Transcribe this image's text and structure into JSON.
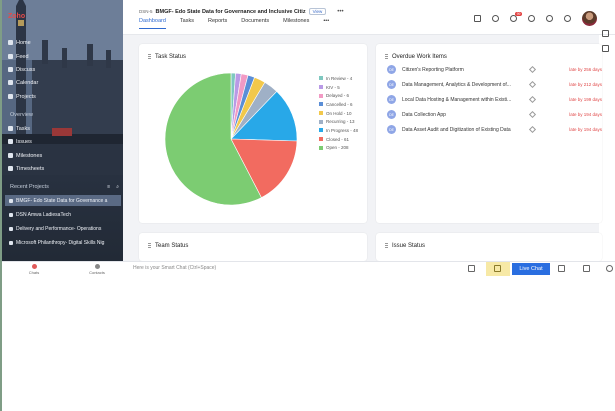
{
  "sidebar": {
    "logo": "Zoho",
    "nav": [
      {
        "label": "Home",
        "icon": "home-icon"
      },
      {
        "label": "Feed",
        "icon": "feed-icon"
      },
      {
        "label": "Discuss",
        "icon": "discuss-icon"
      },
      {
        "label": "Calendar",
        "icon": "calendar-icon"
      },
      {
        "label": "Projects",
        "icon": "projects-icon"
      }
    ],
    "overview_title": "Overview",
    "overview": [
      {
        "label": "Tasks",
        "icon": "tasks-icon"
      },
      {
        "label": "Issues",
        "icon": "issues-icon"
      },
      {
        "label": "Milestones",
        "icon": "milestones-icon"
      },
      {
        "label": "Timesheets",
        "icon": "timesheets-icon"
      }
    ],
    "recent_title": "Recent Projects",
    "recent": [
      {
        "label": "BMGF- Edo State Data for Governance a",
        "active": true
      },
      {
        "label": "DSN Amwa LadiesaTech",
        "active": false
      },
      {
        "label": "Delivery and Performance- Operations",
        "active": false
      },
      {
        "label": "Microsoft Philanthropy- Digital Skills Nig",
        "active": false
      }
    ]
  },
  "header": {
    "project_code": "DSN-5",
    "project_name": "BMGF- Edo State Data for Governance and Inclusive Citiz",
    "view_label": "View",
    "more": "•••",
    "tabs": [
      "Dashboard",
      "Tasks",
      "Reports",
      "Documents",
      "Milestones",
      "•••"
    ],
    "active_tab": "Dashboard",
    "notification_count": "99"
  },
  "task_status": {
    "title": "Task Status",
    "legend": [
      {
        "label": "In Review - 4",
        "color": "#7fc8c0"
      },
      {
        "label": "KIV - 5",
        "color": "#b99ae6"
      },
      {
        "label": "Delayed - 6",
        "color": "#f29ac4"
      },
      {
        "label": "Cancelled - 6",
        "color": "#5b8ed6"
      },
      {
        "label": "On Hold - 10",
        "color": "#f2c84b"
      },
      {
        "label": "Recurring - 13",
        "color": "#9fb0c6"
      },
      {
        "label": "In Progress - 48",
        "color": "#28a8e8"
      },
      {
        "label": "Closed - 61",
        "color": "#f26b60"
      },
      {
        "label": "Open - 208",
        "color": "#7ccc72"
      }
    ]
  },
  "chart_data": {
    "type": "pie",
    "title": "Task Status",
    "slices": [
      {
        "label": "In Review",
        "value": 4,
        "color": "#7fc8c0"
      },
      {
        "label": "KIV",
        "value": 5,
        "color": "#b99ae6"
      },
      {
        "label": "Delayed",
        "value": 6,
        "color": "#f29ac4"
      },
      {
        "label": "Cancelled",
        "value": 6,
        "color": "#5b8ed6"
      },
      {
        "label": "On Hold",
        "value": 10,
        "color": "#f2c84b"
      },
      {
        "label": "Recurring",
        "value": 13,
        "color": "#9fb0c6"
      },
      {
        "label": "In Progress",
        "value": 48,
        "color": "#28a8e8"
      },
      {
        "label": "Closed",
        "value": 61,
        "color": "#f26b60"
      },
      {
        "label": "Open",
        "value": 208,
        "color": "#7ccc72"
      }
    ],
    "legend_position": "right"
  },
  "overdue": {
    "title": "Overdue Work Items",
    "items": [
      {
        "initials": "DE",
        "name": "Citizen's Reporting Platform",
        "late": "late by 256 days"
      },
      {
        "initials": "DE",
        "name": "Data Management, Analytics & Development of...",
        "late": "late by 212 days"
      },
      {
        "initials": "DE",
        "name": "Local Data Hosting & Management within Existi...",
        "late": "late by 199 days"
      },
      {
        "initials": "DE",
        "name": "Data Collection App",
        "late": "late by 194 days"
      },
      {
        "initials": "DE",
        "name": "Data Asset Audit and Digitization of Existing Data",
        "late": "late by 194 days"
      }
    ]
  },
  "team_status": {
    "title": "Team Status"
  },
  "issue_status": {
    "title": "Issue Status"
  },
  "bottom": {
    "chats": "Chats",
    "contacts": "Contacts",
    "smart_chat_placeholder": "Here is your Smart Chat (Ctrl+Space)",
    "live_chat": "Live Chat"
  }
}
